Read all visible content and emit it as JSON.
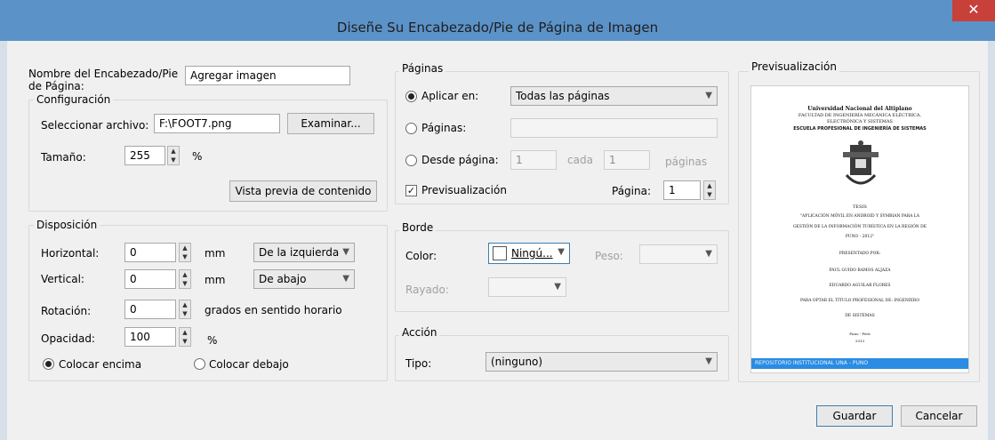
{
  "window": {
    "title": "Diseñe Su Encabezado/Pie de Página de Imagen",
    "close_glyph": "✕"
  },
  "left": {
    "name_label": "Nombre del Encabezado/Pie de Página:",
    "name_value": "Agregar imagen",
    "config": {
      "title": "Configuración",
      "file_label": "Seleccionar archivo:",
      "file_value": "F:\\FOOT7.png",
      "browse_button": "Examinar...",
      "size_label": "Tamaño:",
      "size_value": "255",
      "size_unit": "%",
      "preview_button": "Vista previa de contenido"
    },
    "layout": {
      "title": "Disposición",
      "horizontal_label": "Horizontal:",
      "horizontal_value": "0",
      "horizontal_unit": "mm",
      "horizontal_ref": "De la izquierda",
      "vertical_label": "Vertical:",
      "vertical_value": "0",
      "vertical_unit": "mm",
      "vertical_ref": "De abajo",
      "rotation_label": "Rotación:",
      "rotation_value": "0",
      "rotation_unit": "grados en sentido horario",
      "opacity_label": "Opacidad:",
      "opacity_value": "100",
      "opacity_unit": "%",
      "radio_above": "Colocar encima",
      "radio_below": "Colocar debajo"
    }
  },
  "pages": {
    "title": "Páginas",
    "apply_label": "Aplicar en:",
    "apply_value": "Todas las páginas",
    "pages_label": "Páginas:",
    "from_label": "Desde página:",
    "from_value": "1",
    "every_label": "cada",
    "every_value": "1",
    "pages_suffix": "páginas",
    "preview_check": "Previsualización",
    "page_label": "Página:",
    "page_value": "1"
  },
  "border": {
    "title": "Borde",
    "color_label": "Color:",
    "color_value": "Ningú...",
    "weight_label": "Peso:",
    "dash_label": "Rayado:"
  },
  "action": {
    "title": "Acción",
    "type_label": "Tipo:",
    "type_value": "(ninguno)"
  },
  "preview": {
    "title": "Previsualización",
    "line1": "Universidad Nacional del Altiplano",
    "line2": "FACULTAD DE INGENIERÍA MECÁNICA ELÉCTRICA,",
    "line3": "ELECTRÓNICA Y SISTEMAS",
    "line4": "ESCUELA PROFESIONAL DE INGENIERÍA DE SISTEMAS",
    "tesis": "TESIS",
    "t1": "\"APLICACIÓN MÓVIL EN ANDROID Y SYMBIAN PARA LA",
    "t2": "GESTIÓN DE LA INFORMACIÓN TURÍSTICA EN LA REGIÓN DE",
    "t3": "PUNO - 2012\"",
    "presented": "PRESENTADO POR:",
    "author1": "PAUL GUIDO RAMOS ALJAZA",
    "author2": "EDUARDO AGUILAR FLORES",
    "degree1": "PARA OPTAR EL TÍTULO PROFESIONAL DE: INGENIERO",
    "degree2": "DE SISTEMAS",
    "place": "Puno - Perú",
    "year": "2013",
    "footer": "REPOSITORIO INSTITUCIONAL UNA - PUNO"
  },
  "buttons": {
    "save": "Guardar",
    "cancel": "Cancelar"
  },
  "colors": {
    "titlebar": "#5b92c8",
    "close": "#c7403a",
    "footer": "#2a8ce3"
  }
}
